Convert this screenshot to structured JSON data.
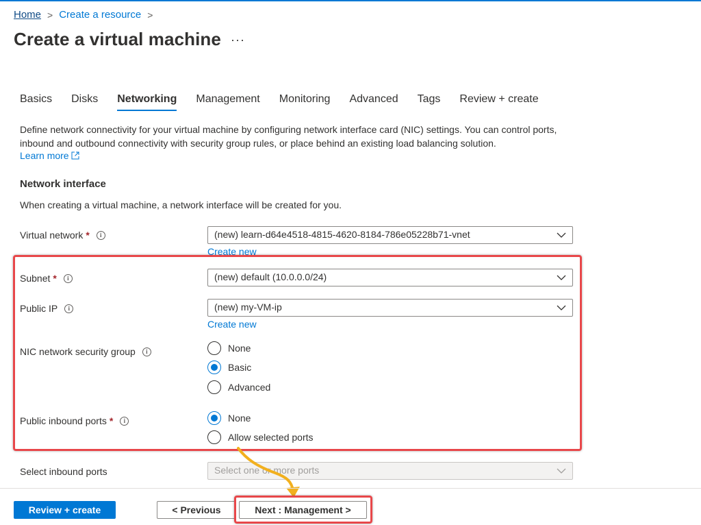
{
  "breadcrumb": {
    "home": "Home",
    "create_resource": "Create a resource",
    "sep": ">"
  },
  "page": {
    "title": "Create a virtual machine",
    "more": "···"
  },
  "tabs": [
    "Basics",
    "Disks",
    "Networking",
    "Management",
    "Monitoring",
    "Advanced",
    "Tags",
    "Review + create"
  ],
  "active_tab": "Networking",
  "description": "Define network connectivity for your virtual machine by configuring network interface card (NIC) settings. You can control ports, inbound and outbound connectivity with security group rules, or place behind an existing load balancing solution.",
  "learn_more": "Learn more",
  "network_interface": {
    "title": "Network interface",
    "desc": "When creating a virtual machine, a network interface will be created for you."
  },
  "fields": {
    "virtual_network": {
      "label": "Virtual network",
      "required": "*",
      "value": "(new) learn-d64e4518-4815-4620-8184-786e05228b71-vnet",
      "link": "Create new"
    },
    "subnet": {
      "label": "Subnet",
      "required": "*",
      "value": "(new) default (10.0.0.0/24)"
    },
    "public_ip": {
      "label": "Public IP",
      "value": "(new) my-VM-ip",
      "link": "Create new"
    },
    "nic_nsg": {
      "label": "NIC network security group",
      "options": [
        "None",
        "Basic",
        "Advanced"
      ],
      "selected": "Basic"
    },
    "public_inbound_ports": {
      "label": "Public inbound ports",
      "required": "*",
      "options": [
        "None",
        "Allow selected ports"
      ],
      "selected": "None"
    },
    "select_inbound_ports": {
      "label": "Select inbound ports",
      "placeholder": "Select one or more ports"
    }
  },
  "footer": {
    "review_create": "Review + create",
    "previous": "< Previous",
    "next": "Next : Management >"
  },
  "colors": {
    "accent": "#0078d4",
    "highlight": "#e8474a",
    "arrow": "#f2b01e",
    "required": "#a4262c"
  },
  "icons": {
    "info": "info-icon",
    "chevron": "chevron-down-icon",
    "external": "external-link-icon"
  }
}
